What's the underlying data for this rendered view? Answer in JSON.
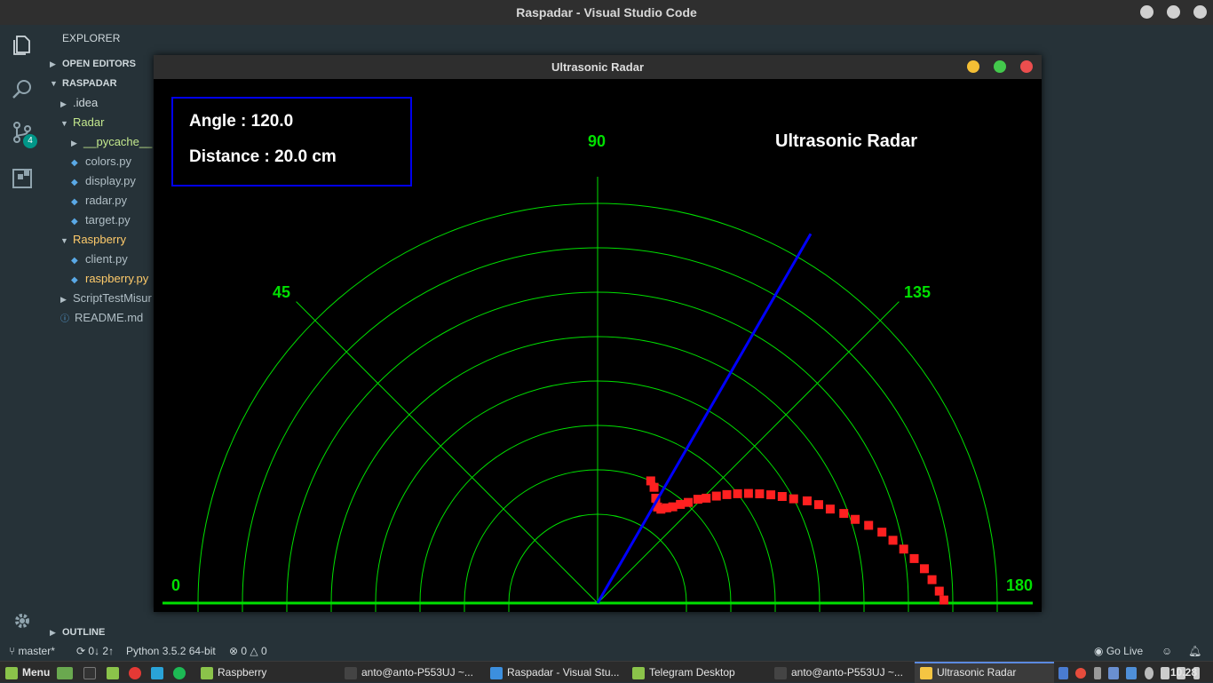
{
  "window_title": "Raspadar - Visual Studio Code",
  "activity": {
    "scm_badge": "4"
  },
  "explorer": {
    "header": "EXPLORER",
    "open_editors": "OPEN EDITORS",
    "project": "RASPADAR",
    "tree": [
      {
        "label": ".idea",
        "kind": "folder",
        "depth": 1,
        "color": "#cfd8dc"
      },
      {
        "label": "Radar",
        "kind": "folder-open",
        "depth": 1,
        "color": "#c3e88d"
      },
      {
        "label": "__pycache__",
        "kind": "folder",
        "depth": 2,
        "color": "#c3e88d"
      },
      {
        "label": "colors.py",
        "kind": "py",
        "depth": 2,
        "color": "#b0bec5"
      },
      {
        "label": "display.py",
        "kind": "py",
        "depth": 2,
        "color": "#b0bec5"
      },
      {
        "label": "radar.py",
        "kind": "py",
        "depth": 2,
        "color": "#b0bec5"
      },
      {
        "label": "target.py",
        "kind": "py",
        "depth": 2,
        "color": "#b0bec5"
      },
      {
        "label": "Raspberry",
        "kind": "folder-open",
        "depth": 1,
        "color": "#ffcb6b"
      },
      {
        "label": "client.py",
        "kind": "py",
        "depth": 2,
        "color": "#b0bec5"
      },
      {
        "label": "raspberry.py",
        "kind": "py",
        "depth": 2,
        "color": "#ffcb6b"
      },
      {
        "label": "ScriptTestMisur",
        "kind": "folder",
        "depth": 1,
        "color": "#b0bec5"
      },
      {
        "label": "README.md",
        "kind": "info",
        "depth": 1,
        "color": "#b0bec5"
      }
    ],
    "outline": "OUTLINE"
  },
  "status": {
    "branch": "master*",
    "sync": "0↓ 2↑",
    "python": "Python 3.5.2 64-bit",
    "errors": "0",
    "warnings": "0",
    "go_live": "Go Live"
  },
  "taskbar": {
    "menu": "Menu",
    "tasks": [
      {
        "label": "Raspberry",
        "icon_color": "#8bc34a"
      },
      {
        "label": "anto@anto-P553UJ ~...",
        "icon_color": "#444"
      },
      {
        "label": "Raspadar - Visual Stu...",
        "icon_color": "#3c8fde"
      },
      {
        "label": "Telegram Desktop",
        "icon_color": "#8bc34a"
      },
      {
        "label": "anto@anto-P553UJ ~...",
        "icon_color": "#444"
      },
      {
        "label": "Ultrasonic Radar",
        "icon_color": "#f5c542"
      }
    ],
    "clock": "10.28"
  },
  "radar_window": {
    "title": "Ultrasonic Radar",
    "angle_text": "Angle : 120.0",
    "distance_text": "Distance : 20.0 cm",
    "heading": "Ultrasonic Radar",
    "angle_labels": [
      "0",
      "45",
      "90",
      "135",
      "180"
    ],
    "sweep_angle_deg": 120.0,
    "colors": {
      "grid": "#00e000",
      "sweep": "#0000ff",
      "target": "#ff2020",
      "text": "#ffffff"
    },
    "target_trail": [
      {
        "ang": 113.5,
        "r": 0.3
      },
      {
        "ang": 116,
        "r": 0.29
      },
      {
        "ang": 119,
        "r": 0.27
      },
      {
        "ang": 122,
        "r": 0.255
      },
      {
        "ang": 124,
        "r": 0.255
      },
      {
        "ang": 126,
        "r": 0.265
      },
      {
        "ang": 128,
        "r": 0.275
      },
      {
        "ang": 130,
        "r": 0.29
      },
      {
        "ang": 132,
        "r": 0.305
      },
      {
        "ang": 134,
        "r": 0.325
      },
      {
        "ang": 136,
        "r": 0.34
      },
      {
        "ang": 138,
        "r": 0.36
      },
      {
        "ang": 140,
        "r": 0.38
      },
      {
        "ang": 142,
        "r": 0.4
      },
      {
        "ang": 144,
        "r": 0.42
      },
      {
        "ang": 146,
        "r": 0.44
      },
      {
        "ang": 148,
        "r": 0.46
      },
      {
        "ang": 150,
        "r": 0.48
      },
      {
        "ang": 152,
        "r": 0.5
      },
      {
        "ang": 154,
        "r": 0.525
      },
      {
        "ang": 156,
        "r": 0.545
      },
      {
        "ang": 158,
        "r": 0.565
      },
      {
        "ang": 160,
        "r": 0.59
      },
      {
        "ang": 162,
        "r": 0.61
      },
      {
        "ang": 164,
        "r": 0.635
      },
      {
        "ang": 166,
        "r": 0.66
      },
      {
        "ang": 168,
        "r": 0.68
      },
      {
        "ang": 170,
        "r": 0.7
      },
      {
        "ang": 172,
        "r": 0.72
      },
      {
        "ang": 174,
        "r": 0.74
      },
      {
        "ang": 176,
        "r": 0.755
      },
      {
        "ang": 178,
        "r": 0.77
      },
      {
        "ang": 179.5,
        "r": 0.78
      }
    ]
  }
}
